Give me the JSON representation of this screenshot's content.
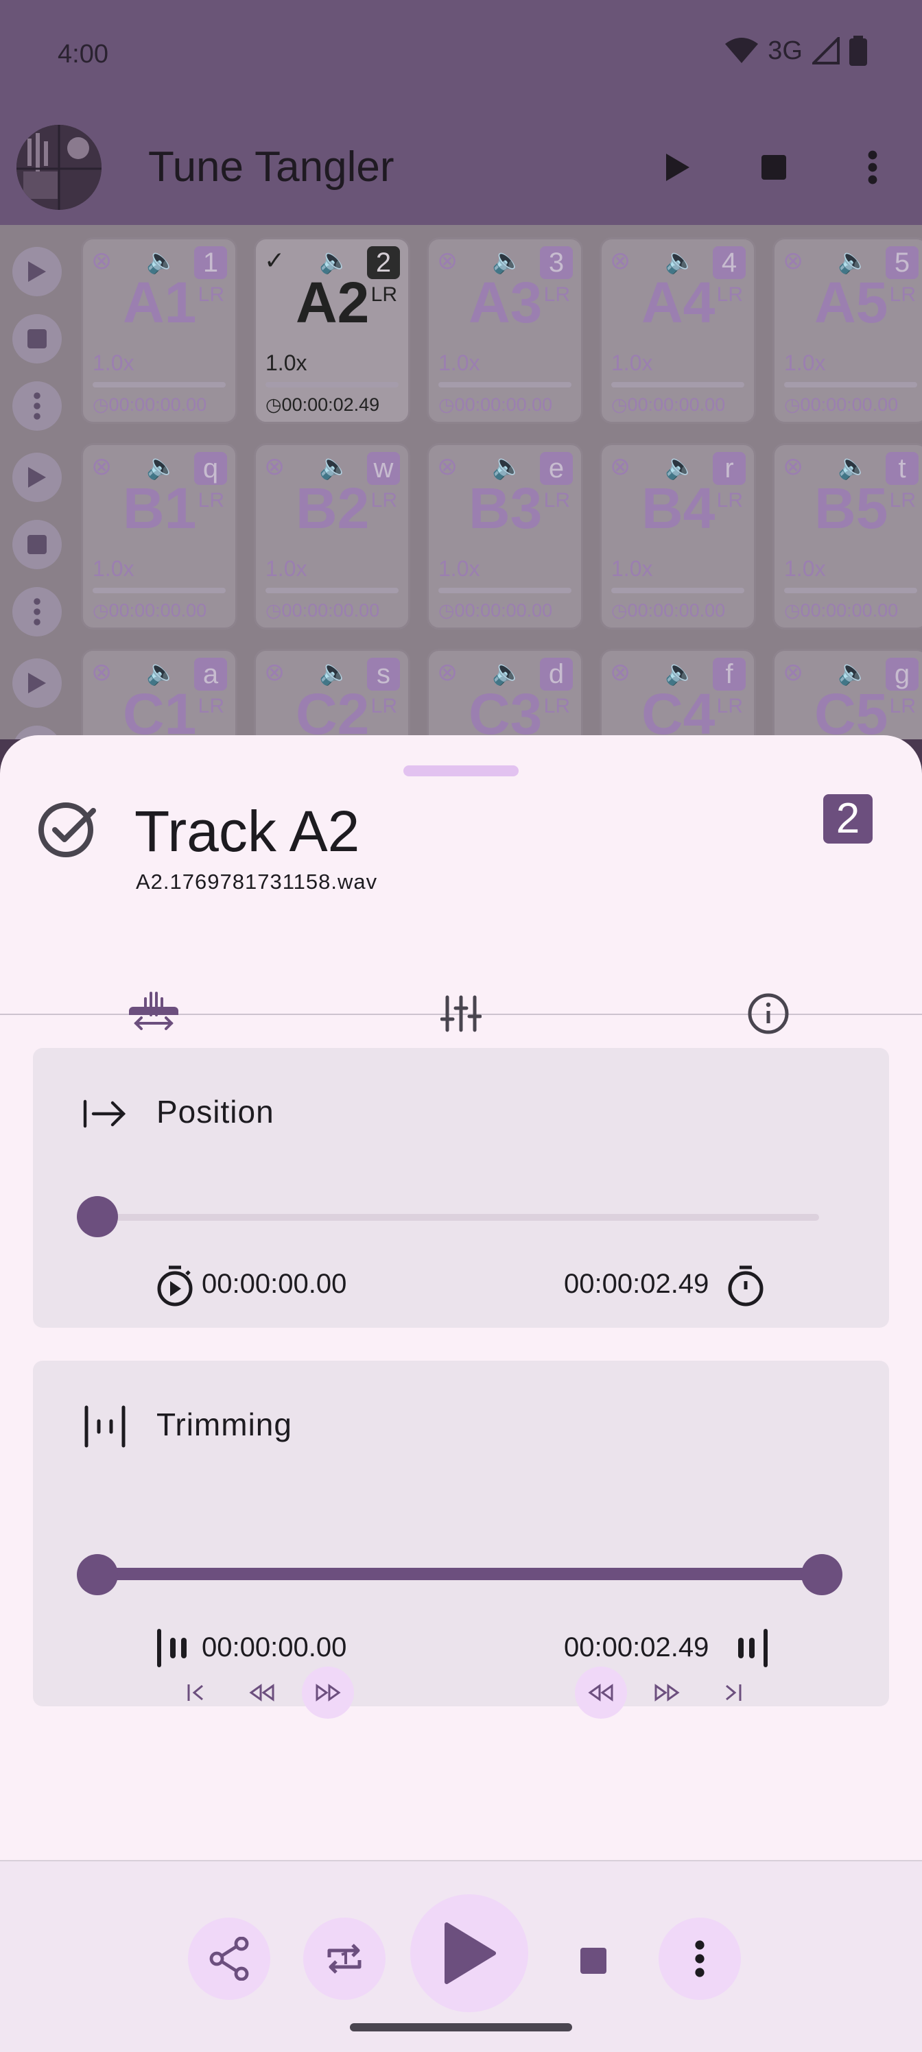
{
  "status_bar": {
    "time": "4:00",
    "network": "3G"
  },
  "app_bar": {
    "title": "Tune Tangler",
    "logo_text": "Tune Tangler"
  },
  "grid": {
    "rows": [
      {
        "pads": [
          {
            "name": "A1",
            "key": "1",
            "speed": "1.0x",
            "time": "00:00:00.00",
            "active": false
          },
          {
            "name": "A2",
            "key": "2",
            "speed": "1.0x",
            "time": "00:00:02.49",
            "active": true
          },
          {
            "name": "A3",
            "key": "3",
            "speed": "1.0x",
            "time": "00:00:00.00",
            "active": false
          },
          {
            "name": "A4",
            "key": "4",
            "speed": "1.0x",
            "time": "00:00:00.00",
            "active": false
          },
          {
            "name": "A5",
            "key": "5",
            "speed": "1.0x",
            "time": "00:00:00.00",
            "active": false
          }
        ]
      },
      {
        "pads": [
          {
            "name": "B1",
            "key": "q",
            "speed": "1.0x",
            "time": "00:00:00.00",
            "active": false
          },
          {
            "name": "B2",
            "key": "w",
            "speed": "1.0x",
            "time": "00:00:00.00",
            "active": false
          },
          {
            "name": "B3",
            "key": "e",
            "speed": "1.0x",
            "time": "00:00:00.00",
            "active": false
          },
          {
            "name": "B4",
            "key": "r",
            "speed": "1.0x",
            "time": "00:00:00.00",
            "active": false
          },
          {
            "name": "B5",
            "key": "t",
            "speed": "1.0x",
            "time": "00:00:00.00",
            "active": false
          }
        ]
      },
      {
        "pads": [
          {
            "name": "C1",
            "key": "a",
            "speed": "",
            "time": "",
            "active": false
          },
          {
            "name": "C2",
            "key": "s",
            "speed": "",
            "time": "",
            "active": false
          },
          {
            "name": "C3",
            "key": "d",
            "speed": "",
            "time": "",
            "active": false
          },
          {
            "name": "C4",
            "key": "f",
            "speed": "",
            "time": "",
            "active": false
          },
          {
            "name": "C5",
            "key": "g",
            "speed": "",
            "time": "",
            "active": false
          }
        ]
      }
    ],
    "lr_label": "LR"
  },
  "sheet": {
    "title": "Track A2",
    "file_name": "A2.1769781731158.wav",
    "key": "2",
    "tabs": [
      {
        "icon": "waveform-resize-icon",
        "selected": true
      },
      {
        "icon": "sliders-icon",
        "selected": false
      },
      {
        "icon": "info-icon",
        "selected": false
      }
    ],
    "position": {
      "label": "Position",
      "start_time": "00:00:00.00",
      "end_time": "00:00:02.49",
      "value": 0
    },
    "trimming": {
      "label": "Trimming",
      "start_time": "00:00:00.00",
      "end_time": "00:00:02.49",
      "range": [
        0,
        1
      ]
    }
  },
  "colors": {
    "accent": "#6c4f7e",
    "sheet_bg": "#fbf0f8",
    "card_bg": "#ebe3ec",
    "button_tint": "#f0d8f8"
  }
}
